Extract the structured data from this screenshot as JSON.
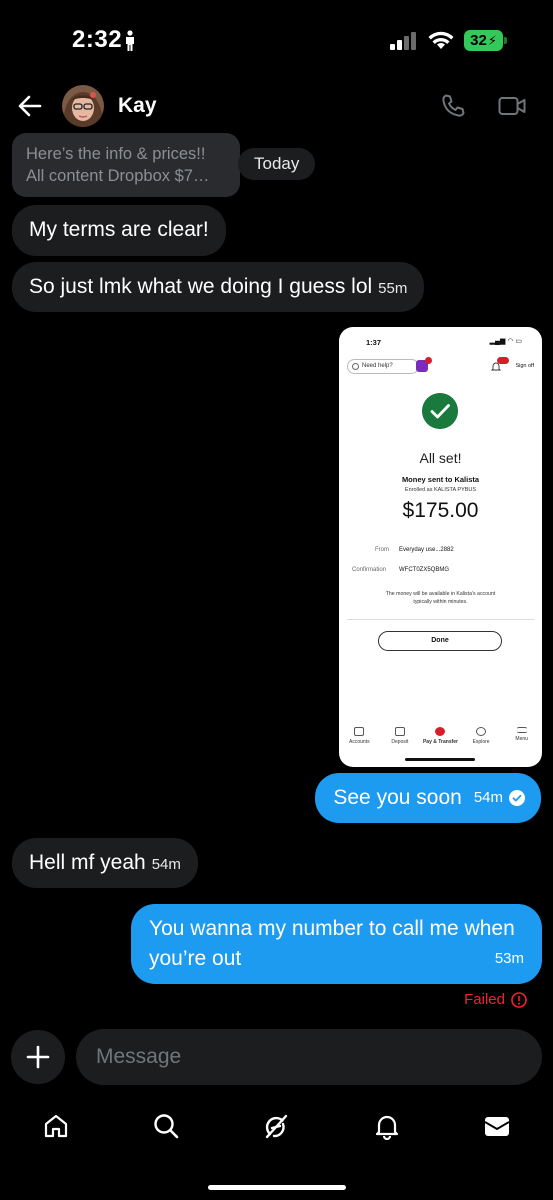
{
  "status_bar": {
    "time": "2:32",
    "battery": "32"
  },
  "header": {
    "contact_name": "Kay"
  },
  "quoted_message": {
    "line1": "Here’s the info & prices!!",
    "line2": "All content Dropbox $7…"
  },
  "date_chip": "Today",
  "messages": [
    {
      "direction": "in",
      "text": "My terms are clear!",
      "time": ""
    },
    {
      "direction": "in",
      "text": "So just lmk what we doing I guess lol",
      "time": "55m"
    },
    {
      "direction": "out",
      "text": "See you soon",
      "time": "54m"
    },
    {
      "direction": "in",
      "text": "Hell mf yeah",
      "time": "54m"
    },
    {
      "direction": "out",
      "text": "You wanna my number to call me when you’re out",
      "time": "53m"
    }
  ],
  "failed_label": "Failed",
  "attachment": {
    "time": "1:37",
    "help": "Need help?",
    "sign_off": "Sign off",
    "title": "All set!",
    "sent_to": "Money sent to Kalista",
    "enrolled": "Enrolled as KALISTA PYBUS",
    "amount": "$175.00",
    "from_label": "From",
    "from_value": "Everyday use...2882",
    "confirmation_label": "Confirmation",
    "confirmation_value": "WFCT0ZX5QBMG",
    "note": "The money will be available in Kalista’s account typically within minutes.",
    "done": "Done",
    "nav": [
      "Accounts",
      "Deposit",
      "Pay & Transfer",
      "Explore",
      "Menu"
    ]
  },
  "composer": {
    "placeholder": "Message"
  },
  "colors": {
    "outgoing": "#1d9bf0",
    "incoming": "#1c1d1f",
    "failed": "#f4212e",
    "background": "#000000"
  },
  "icons": [
    "back-arrow-icon",
    "phone-icon",
    "video-icon",
    "plus-icon",
    "home-icon",
    "search-icon",
    "grok-icon",
    "bell-icon",
    "mail-icon"
  ]
}
